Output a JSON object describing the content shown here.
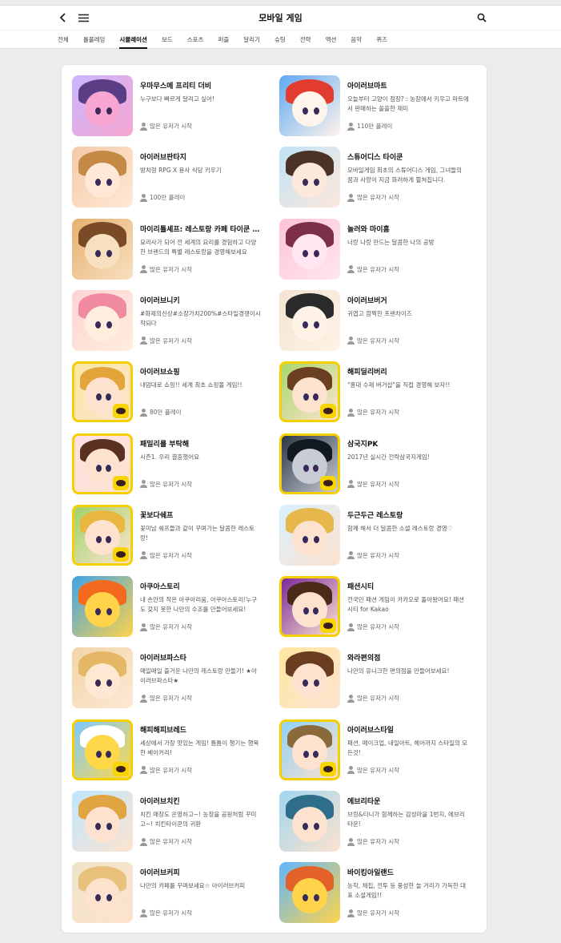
{
  "header": {
    "title": "모바일 게임"
  },
  "tabs": [
    "전체",
    "롤플레잉",
    "시뮬레이션",
    "보드",
    "스포츠",
    "퍼즐",
    "달리기",
    "슈팅",
    "전략",
    "액션",
    "음악",
    "퀴즈"
  ],
  "active_tab": "시뮬레이션",
  "games": [
    {
      "name": "우마무스메 프리티 더비",
      "desc": "누구보다 빠르게 달리고 싶어!",
      "meta": "많은 유저가 시작",
      "colors": [
        "#c9b6ff",
        "#5b3d86",
        "#f6a6d0"
      ],
      "kakao": false
    },
    {
      "name": "아이러브마트",
      "desc": "오늘부터 고양이 점장? : 농장에서 키우고 마트에서 판매하는 쏠쏠한 재미",
      "meta": "110만 플레이",
      "colors": [
        "#5fa8f2",
        "#e23b2f",
        "#fff4ec"
      ],
      "kakao": false
    },
    {
      "name": "아이러브판타지",
      "desc": "방치형 RPG X 용사 식당 키우기",
      "meta": "100만 플레이",
      "colors": [
        "#f4c9a6",
        "#c48a45",
        "#ffe9d6"
      ],
      "kakao": false
    },
    {
      "name": "스튜어디스 타이쿤",
      "desc": "모바일게임 최초의 스튜어디스 게임, 그녀들의 꿈과 사랑이 지금 화려하게 펼쳐집니다.",
      "meta": "많은 유저가 시작",
      "colors": [
        "#bfe3f6",
        "#4a3326",
        "#fde8dc"
      ],
      "kakao": false
    },
    {
      "name": "마이리틀셰프: 레스토랑 카페 타이쿤 경영",
      "desc": "요리사가 되어 전 세계의 요리를 경험하고 다양한 브랜드의 특별 레스토랑을 경영해보세요",
      "meta": "많은 유저가 시작",
      "colors": [
        "#e7b070",
        "#7a4a26",
        "#f7e0c0"
      ],
      "kakao": false
    },
    {
      "name": "놀러와 마이홈",
      "desc": "너랑 나랑 만드는 달콤한 나의 공방",
      "meta": "많은 유저가 시작",
      "colors": [
        "#ffc3d8",
        "#7b2f4a",
        "#ffe6f0"
      ],
      "kakao": false
    },
    {
      "name": "아이러브니키",
      "desc": "#화제의신상#소장가치200%#스타일경쟁이시작되다",
      "meta": "많은 유저가 시작",
      "colors": [
        "#fcd4d4",
        "#f08aa0",
        "#ffeede"
      ],
      "kakao": false
    },
    {
      "name": "아이러브버거",
      "desc": "귀엽고 깜찍한 프랜차이즈",
      "meta": "많은 유저가 시작",
      "colors": [
        "#f3e4d2",
        "#2a2a2a",
        "#fff2e6"
      ],
      "kakao": false
    },
    {
      "name": "아이러브쇼핑",
      "desc": "내맘대로 쇼핑!! 세계 최초 쇼핑몰 게임!!",
      "meta": "80만 플레이",
      "colors": [
        "#fbe7a4",
        "#e2a43b",
        "#fde3cf"
      ],
      "kakao": true
    },
    {
      "name": "해피딜리버리",
      "desc": "\"홍대 수제 버거샵\"을 직접 경영해 보자!!",
      "meta": "많은 유저가 시작",
      "colors": [
        "#a7d86a",
        "#6b3f22",
        "#fde3cf"
      ],
      "kakao": true
    },
    {
      "name": "패밀리를 부탁해",
      "desc": "시즌1. 우리 결혼했어요",
      "meta": "많은 유저가 시작",
      "colors": [
        "#fde0e6",
        "#5a3020",
        "#fde3cf"
      ],
      "kakao": true
    },
    {
      "name": "삼국지PK",
      "desc": "2017년 실시간 전략삼국지게임!",
      "meta": "많은 유저가 시작",
      "colors": [
        "#2b3645",
        "#111820",
        "#c8ccd4"
      ],
      "kakao": true
    },
    {
      "name": "꽃보다쉐프",
      "desc": "꽃미남 쉐프들과 같이 꾸며가는 달콤한 레스토랑!",
      "meta": "많은 유저가 시작",
      "colors": [
        "#9ed36a",
        "#e9b640",
        "#fde3cf"
      ],
      "kakao": true
    },
    {
      "name": "두근두근 레스토랑",
      "desc": "함께 해서 더 달콤한 소셜 레스토랑 경영♡",
      "meta": "많은 유저가 시작",
      "colors": [
        "#d8f0ff",
        "#e6b74a",
        "#fde3cf"
      ],
      "kakao": false
    },
    {
      "name": "아쿠아스토리",
      "desc": "내 손안의 작은 아쿠아리움, 아쿠아스토리!누구도 갖지 못한 나만의 수조를 만들어보세요!",
      "meta": "많은 유저가 시작",
      "colors": [
        "#3fa3e8",
        "#f36a1e",
        "#ffd34a"
      ],
      "kakao": false
    },
    {
      "name": "패션시티",
      "desc": "전국민 패션 게임이 카카오로 돌아왔어요! 패션시티 for Kakao",
      "meta": "많은 유저가 시작",
      "colors": [
        "#7a2a9a",
        "#4b2a1a",
        "#fde3cf"
      ],
      "kakao": true
    },
    {
      "name": "아이러브파스타",
      "desc": "매일매일 즐거운 나만의 레스토랑 만들기! ★아이러브파스타★",
      "meta": "많은 유저가 시작",
      "colors": [
        "#f1d6a8",
        "#e5b867",
        "#fde8d4"
      ],
      "kakao": false
    },
    {
      "name": "와라편의점",
      "desc": "나만의 유니크한 편의점을 만들어보세요!",
      "meta": "많은 유저가 시작",
      "colors": [
        "#ffe7a0",
        "#6a3d20",
        "#fde3cf"
      ],
      "kakao": false
    },
    {
      "name": "해피해피브레드",
      "desc": "세상에서 가장 맛있는 게임! 틈틈이 챙기는 행복한 베이커리!",
      "meta": "많은 유저가 시작",
      "colors": [
        "#7ec9ff",
        "#ffffff",
        "#ffd84a"
      ],
      "kakao": true
    },
    {
      "name": "아이러브스타일",
      "desc": "패션, 메이크업, 네일아트, 헤어까지 스타일의 모든것!",
      "meta": "많은 유저가 시작",
      "colors": [
        "#8fd0f5",
        "#8a6a3a",
        "#fde3cf"
      ],
      "kakao": true
    },
    {
      "name": "아이러브치킨",
      "desc": "치킨 매장도 운영하고~! 농장을 공원처럼 꾸미고~! 치킨타이쿤의 귀환",
      "meta": "많은 유저가 시작",
      "colors": [
        "#bfe7ff",
        "#e0a440",
        "#fde3cf"
      ],
      "kakao": false
    },
    {
      "name": "에브리타운",
      "desc": "브링&티니가 함께하는 감성마을 1번지, 에브리타운!",
      "meta": "많은 유저가 시작",
      "colors": [
        "#9fd6f0",
        "#2f6e8a",
        "#fde3cf"
      ],
      "kakao": false
    },
    {
      "name": "아이러브커피",
      "desc": "나만의 카페를 꾸며보세요☆ 아이러브커피",
      "meta": "많은 유저가 시작",
      "colors": [
        "#efe4c8",
        "#e8c27a",
        "#fde3cf"
      ],
      "kakao": false
    },
    {
      "name": "바이킹아일랜드",
      "desc": "농작, 채집, 전투 등 풍성한 놀 거리가 가득한 대표 소셜게임!!",
      "meta": "많은 유저가 시작",
      "colors": [
        "#5fb7ff",
        "#e2622a",
        "#ffd34a"
      ],
      "kakao": false
    }
  ]
}
